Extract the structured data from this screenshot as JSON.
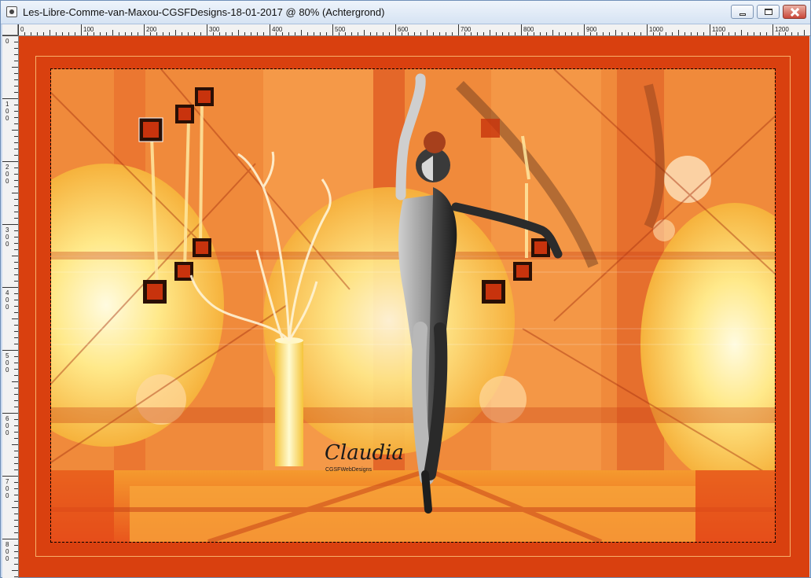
{
  "window": {
    "title": "Les-Libre-Comme-van-Maxou-CGSFDesigns-18-01-2017 @  80% (Achtergrond)"
  },
  "icons": {
    "app": "paint-shop-pro-document-icon",
    "minimize": "minimize-icon",
    "maximize": "maximize-icon",
    "close": "close-icon"
  },
  "ruler": {
    "top_labels": [
      "0",
      "100",
      "200",
      "300",
      "400",
      "500",
      "600",
      "700",
      "800",
      "900",
      "1000",
      "1100",
      "1200"
    ],
    "left_labels": [
      "0",
      "100",
      "200",
      "300",
      "400",
      "500",
      "600",
      "700",
      "800"
    ]
  },
  "artwork": {
    "signature": "Claudia",
    "signature_sub": "CGSFWebDesigns"
  },
  "colors": {
    "canvas_border": "#d9400f",
    "gold_frame": "#f7b06a",
    "close_button": "#c9473a"
  }
}
